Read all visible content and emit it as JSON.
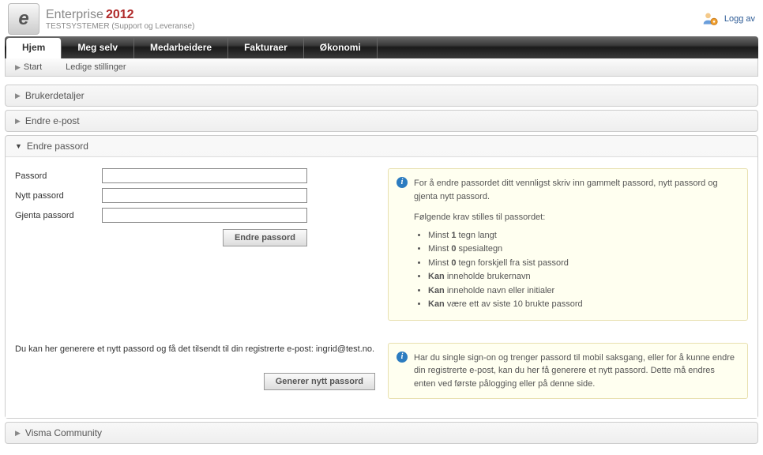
{
  "brand": {
    "name": "Enterprise",
    "year": "2012",
    "subtitle": "TESTSYSTEMER (Support og Leveranse)"
  },
  "header": {
    "logoff": "Logg av"
  },
  "tabs": {
    "t0": "Hjem",
    "t1": "Meg selv",
    "t2": "Medarbeidere",
    "t3": "Fakturaer",
    "t4": "Økonomi"
  },
  "subbar": {
    "s0": "Start",
    "s1": "Ledige stillinger"
  },
  "panels": {
    "p0": "Brukerdetaljer",
    "p1": "Endre e-post",
    "p2": "Endre passord",
    "p3": "Visma Community"
  },
  "form": {
    "passord_label": "Passord",
    "nytt_label": "Nytt passord",
    "gjenta_label": "Gjenta passord",
    "submit": "Endre passord",
    "generate_btn": "Generer nytt passord"
  },
  "info1": {
    "line1": "For å endre passordet ditt vennligst skriv inn gammelt passord, nytt passord og gjenta nytt passord.",
    "line2": "Følgende krav stilles til passordet:",
    "rules": {
      "r0a": "Minst ",
      "r0b": "1",
      "r0c": " tegn langt",
      "r1a": "Minst ",
      "r1b": "0",
      "r1c": " spesialtegn",
      "r2a": "Minst ",
      "r2b": "0",
      "r2c": " tegn forskjell fra sist passord",
      "r3a": "Kan",
      "r3b": " inneholde brukernavn",
      "r4a": "Kan",
      "r4b": " inneholde navn eller initialer",
      "r5a": "Kan",
      "r5b": " være ett av siste 10 brukte passord"
    }
  },
  "generate_text": "Du kan her generere et nytt passord og få det tilsendt til din registrerte e-post: ingrid@test.no.",
  "info2": "Har du single sign-on og trenger passord til mobil saksgang, eller for å kunne endre din registrerte e-post, kan du her få generere et nytt passord. Dette må endres enten ved første pålogging eller på denne side."
}
